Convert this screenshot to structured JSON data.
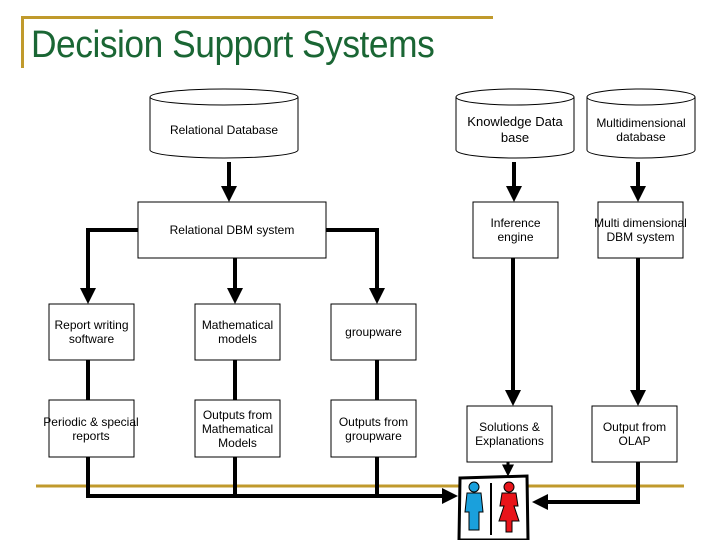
{
  "title": "Decision Support Systems",
  "colors": {
    "title": "#1a6634",
    "accent_line": "#c09a2c",
    "arrow": "#000000",
    "person_male": "#1aa0dc",
    "person_female": "#e8141a"
  },
  "nodes": {
    "relational_database": {
      "label": "Relational Database",
      "shape": "cylinder"
    },
    "relational_dbm_system": {
      "label": "Relational DBM system",
      "shape": "box"
    },
    "knowledge_database": {
      "label": "Knowledge Data\nbase",
      "shape": "cylinder"
    },
    "multidimensional_database": {
      "label": "Multidimensional\ndatabase",
      "shape": "cylinder"
    },
    "inference_engine": {
      "label": "Inference\nengine",
      "shape": "box"
    },
    "multidimensional_dbm_system": {
      "label": "Multi dimensional\nDBM system",
      "shape": "box"
    },
    "report_writing_software": {
      "label": "Report writing\nsoftware",
      "shape": "box"
    },
    "mathematical_models": {
      "label": "Mathematical\nmodels",
      "shape": "box"
    },
    "groupware": {
      "label": "groupware",
      "shape": "box"
    },
    "periodic_special_reports": {
      "label": "Periodic & special\nreports",
      "shape": "box"
    },
    "outputs_mathematical_models": {
      "label": "Outputs from\nMathematical\nModels",
      "shape": "box"
    },
    "outputs_groupware": {
      "label": "Outputs from\ngroupware",
      "shape": "box"
    },
    "solutions_explanations": {
      "label": "Solutions &\nExplanations",
      "shape": "box"
    },
    "output_olap": {
      "label": "Output from\nOLAP",
      "shape": "box"
    }
  },
  "users_icon": "users-icon"
}
